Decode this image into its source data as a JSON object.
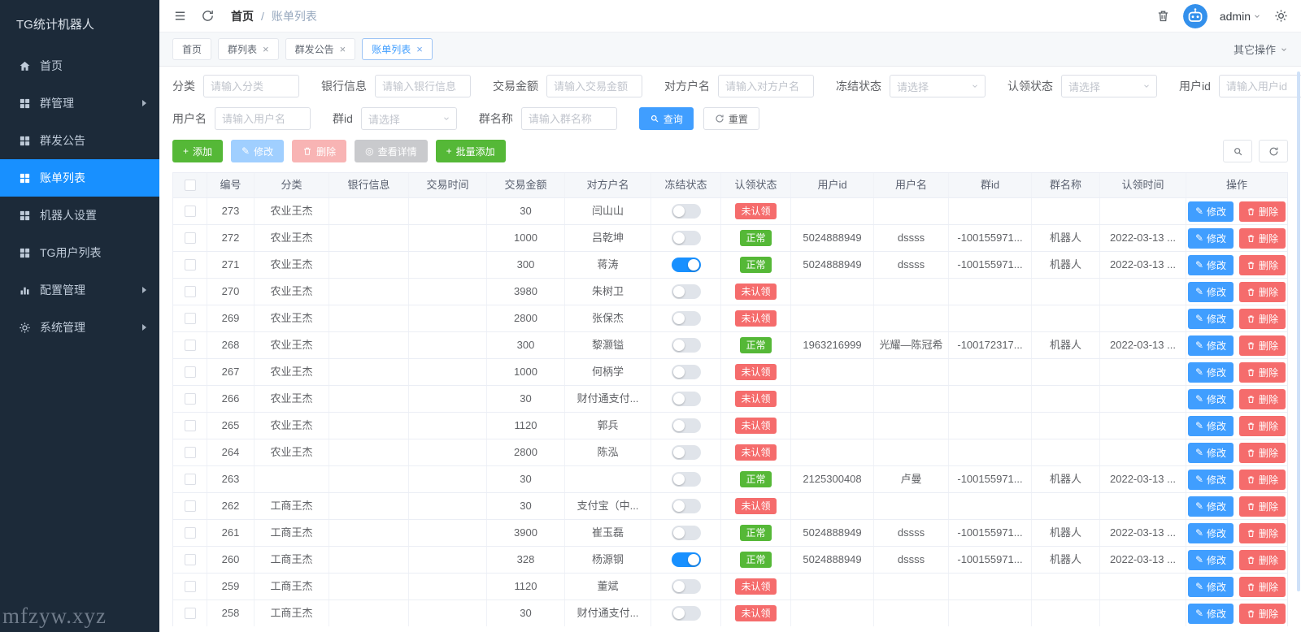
{
  "app": {
    "title": "TG统计机器人",
    "watermark": "mfzyw.xyz"
  },
  "sidebar": {
    "items": [
      {
        "label": "首页",
        "icon": "home",
        "active": false,
        "has_arrow": false
      },
      {
        "label": "群管理",
        "icon": "grid",
        "active": false,
        "has_arrow": true
      },
      {
        "label": "群发公告",
        "icon": "grid",
        "active": false,
        "has_arrow": false
      },
      {
        "label": "账单列表",
        "icon": "grid",
        "active": true,
        "has_arrow": false
      },
      {
        "label": "机器人设置",
        "icon": "grid",
        "active": false,
        "has_arrow": false
      },
      {
        "label": "TG用户列表",
        "icon": "grid",
        "active": false,
        "has_arrow": false
      },
      {
        "label": "配置管理",
        "icon": "bar-chart",
        "active": false,
        "has_arrow": true
      },
      {
        "label": "系统管理",
        "icon": "gear",
        "active": false,
        "has_arrow": true
      }
    ]
  },
  "navbar": {
    "breadcrumb": {
      "home": "首页",
      "separator": "/",
      "current": "账单列表"
    },
    "username": "admin"
  },
  "tabbar": {
    "tabs": [
      {
        "label": "首页",
        "closable": false,
        "active": false
      },
      {
        "label": "群列表",
        "closable": true,
        "active": false
      },
      {
        "label": "群发公告",
        "closable": true,
        "active": false
      },
      {
        "label": "账单列表",
        "closable": true,
        "active": true
      }
    ],
    "more_label": "其它操作"
  },
  "filters": {
    "row1": [
      {
        "label": "分类",
        "type": "input",
        "placeholder": "请输入分类"
      },
      {
        "label": "银行信息",
        "type": "input",
        "placeholder": "请输入银行信息"
      },
      {
        "label": "交易金额",
        "type": "input",
        "placeholder": "请输入交易金额"
      },
      {
        "label": "对方户名",
        "type": "input",
        "placeholder": "请输入对方户名"
      },
      {
        "label": "冻结状态",
        "type": "select",
        "placeholder": "请选择"
      },
      {
        "label": "认领状态",
        "type": "select",
        "placeholder": "请选择"
      },
      {
        "label": "用户id",
        "type": "input",
        "placeholder": "请输入用户id"
      }
    ],
    "row2": [
      {
        "label": "用户名",
        "type": "input",
        "placeholder": "请输入用户名"
      },
      {
        "label": "群id",
        "type": "select",
        "placeholder": "请选择"
      },
      {
        "label": "群名称",
        "type": "input",
        "placeholder": "请输入群名称"
      }
    ],
    "search_label": "查询",
    "reset_label": "重置"
  },
  "toolbar": {
    "add_label": "添加",
    "edit_label": "修改",
    "delete_label": "删除",
    "detail_label": "查看详情",
    "batch_add_label": "批量添加"
  },
  "table": {
    "columns": [
      "编号",
      "分类",
      "银行信息",
      "交易时间",
      "交易金额",
      "对方户名",
      "冻结状态",
      "认领状态",
      "用户id",
      "用户名",
      "群id",
      "群名称",
      "认领时间",
      "操作"
    ],
    "status_normal": "正常",
    "status_unclaimed": "未认领",
    "row_edit_label": "修改",
    "row_delete_label": "删除",
    "rows": [
      {
        "id": "273",
        "category": "农业王杰",
        "bank": "",
        "trade_time": "",
        "amount": "30",
        "counterparty": "闫山山",
        "frozen": false,
        "claim": "unclaimed",
        "user_id": "",
        "user_name": "",
        "group_id": "",
        "group_name": "",
        "claim_time": ""
      },
      {
        "id": "272",
        "category": "农业王杰",
        "bank": "",
        "trade_time": "",
        "amount": "1000",
        "counterparty": "吕乾坤",
        "frozen": false,
        "claim": "normal",
        "user_id": "5024888949",
        "user_name": "dssss",
        "group_id": "-100155971...",
        "group_name": "机器人",
        "claim_time": "2022-03-13 ..."
      },
      {
        "id": "271",
        "category": "农业王杰",
        "bank": "",
        "trade_time": "",
        "amount": "300",
        "counterparty": "蒋涛",
        "frozen": true,
        "claim": "normal",
        "user_id": "5024888949",
        "user_name": "dssss",
        "group_id": "-100155971...",
        "group_name": "机器人",
        "claim_time": "2022-03-13 ..."
      },
      {
        "id": "270",
        "category": "农业王杰",
        "bank": "",
        "trade_time": "",
        "amount": "3980",
        "counterparty": "朱树卫",
        "frozen": false,
        "claim": "unclaimed",
        "user_id": "",
        "user_name": "",
        "group_id": "",
        "group_name": "",
        "claim_time": ""
      },
      {
        "id": "269",
        "category": "农业王杰",
        "bank": "",
        "trade_time": "",
        "amount": "2800",
        "counterparty": "张保杰",
        "frozen": false,
        "claim": "unclaimed",
        "user_id": "",
        "user_name": "",
        "group_id": "",
        "group_name": "",
        "claim_time": ""
      },
      {
        "id": "268",
        "category": "农业王杰",
        "bank": "",
        "trade_time": "",
        "amount": "300",
        "counterparty": "黎灏镒",
        "frozen": false,
        "claim": "normal",
        "user_id": "1963216999",
        "user_name": "光耀—陈冠希",
        "group_id": "-100172317...",
        "group_name": "机器人",
        "claim_time": "2022-03-13 ..."
      },
      {
        "id": "267",
        "category": "农业王杰",
        "bank": "",
        "trade_time": "",
        "amount": "1000",
        "counterparty": "何柄学",
        "frozen": false,
        "claim": "unclaimed",
        "user_id": "",
        "user_name": "",
        "group_id": "",
        "group_name": "",
        "claim_time": ""
      },
      {
        "id": "266",
        "category": "农业王杰",
        "bank": "",
        "trade_time": "",
        "amount": "30",
        "counterparty": "财付通支付...",
        "frozen": false,
        "claim": "unclaimed",
        "user_id": "",
        "user_name": "",
        "group_id": "",
        "group_name": "",
        "claim_time": ""
      },
      {
        "id": "265",
        "category": "农业王杰",
        "bank": "",
        "trade_time": "",
        "amount": "1120",
        "counterparty": "郭兵",
        "frozen": false,
        "claim": "unclaimed",
        "user_id": "",
        "user_name": "",
        "group_id": "",
        "group_name": "",
        "claim_time": ""
      },
      {
        "id": "264",
        "category": "农业王杰",
        "bank": "",
        "trade_time": "",
        "amount": "2800",
        "counterparty": "陈泓",
        "frozen": false,
        "claim": "unclaimed",
        "user_id": "",
        "user_name": "",
        "group_id": "",
        "group_name": "",
        "claim_time": ""
      },
      {
        "id": "263",
        "category": "",
        "bank": "",
        "trade_time": "",
        "amount": "30",
        "counterparty": "",
        "frozen": false,
        "claim": "normal",
        "user_id": "2125300408",
        "user_name": "卢曼",
        "group_id": "-100155971...",
        "group_name": "机器人",
        "claim_time": "2022-03-13 ..."
      },
      {
        "id": "262",
        "category": "工商王杰",
        "bank": "",
        "trade_time": "",
        "amount": "30",
        "counterparty": "支付宝（中...",
        "frozen": false,
        "claim": "unclaimed",
        "user_id": "",
        "user_name": "",
        "group_id": "",
        "group_name": "",
        "claim_time": ""
      },
      {
        "id": "261",
        "category": "工商王杰",
        "bank": "",
        "trade_time": "",
        "amount": "3900",
        "counterparty": "崔玉磊",
        "frozen": false,
        "claim": "normal",
        "user_id": "5024888949",
        "user_name": "dssss",
        "group_id": "-100155971...",
        "group_name": "机器人",
        "claim_time": "2022-03-13 ..."
      },
      {
        "id": "260",
        "category": "工商王杰",
        "bank": "",
        "trade_time": "",
        "amount": "328",
        "counterparty": "杨源钢",
        "frozen": true,
        "claim": "normal",
        "user_id": "5024888949",
        "user_name": "dssss",
        "group_id": "-100155971...",
        "group_name": "机器人",
        "claim_time": "2022-03-13 ..."
      },
      {
        "id": "259",
        "category": "工商王杰",
        "bank": "",
        "trade_time": "",
        "amount": "1120",
        "counterparty": "董斌",
        "frozen": false,
        "claim": "unclaimed",
        "user_id": "",
        "user_name": "",
        "group_id": "",
        "group_name": "",
        "claim_time": ""
      },
      {
        "id": "258",
        "category": "工商王杰",
        "bank": "",
        "trade_time": "",
        "amount": "30",
        "counterparty": "财付通支付...",
        "frozen": false,
        "claim": "unclaimed",
        "user_id": "",
        "user_name": "",
        "group_id": "",
        "group_name": "",
        "claim_time": ""
      }
    ]
  },
  "icons": {
    "hamburger-icon": "three horizontal bars",
    "refresh-icon": "circular arrow",
    "trash-icon": "trash can outline",
    "gear-icon": "settings gear",
    "search-icon": "magnifier",
    "plus-icon": "+",
    "edit-icon": "pencil ✎",
    "detail-icon": "◎",
    "chevron-down-icon": "∨",
    "chevron-right-icon": "▶"
  },
  "colors": {
    "accent": "#409eff",
    "success": "#55b837",
    "danger": "#f56c6c",
    "sidebar_bg": "#1c2a39",
    "active_menu_bg": "#1890ff",
    "table_header_bg": "#f5f7fa"
  }
}
